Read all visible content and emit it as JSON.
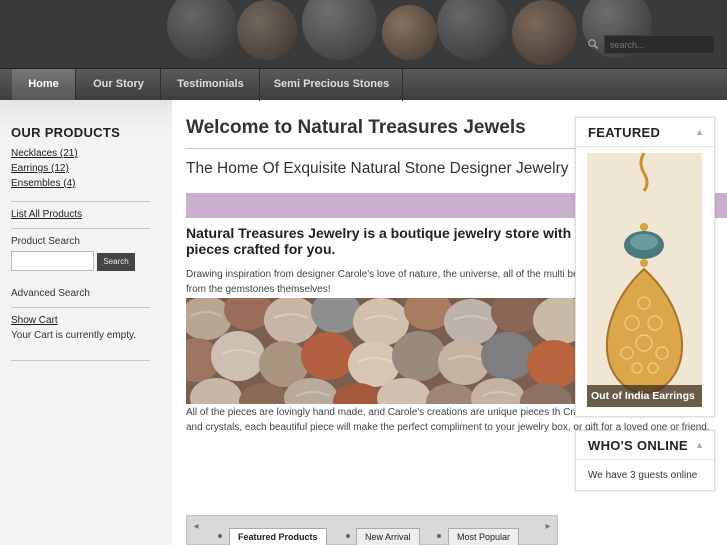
{
  "header": {
    "search_placeholder": "search..."
  },
  "nav": {
    "tabs": [
      "Home",
      "Our Story",
      "Testimonials",
      "Semi Precious Stones"
    ],
    "active_tab": "Home"
  },
  "sidebar": {
    "heading": "OUR PRODUCTS",
    "categories": [
      "Necklaces (21)",
      "Earrings (12)",
      "Ensembles (4)"
    ],
    "list_all": "List All Products",
    "product_search_label": "Product Search",
    "search_button": "Search",
    "advanced_search": "Advanced Search",
    "show_cart": "Show Cart",
    "cart_status": "Your Cart is currently empty."
  },
  "main": {
    "title": "Welcome to Natural Treasures Jewels",
    "subtitle": "The Home Of Exquisite Natural Stone Designer Jewelry",
    "intro_heading": "Natural Treasures Jewelry is a boutique jewelry store with pieces crafted for you.",
    "paragraph_1": "Drawing inspiration from designer Carole's love of nature, the universe, all of the multi beautiful pieces of art, and also from the gemstones themselves!",
    "paragraph_2": "All of the pieces are lovingly hand made, and Carole's creations are unique pieces th Crafted from semi precious stones and crystals, each beautiful piece will make the perfect compliment to your jewelry box, or gift for a loved one or friend.",
    "product_tabs": [
      "Featured Products",
      "New Arrival",
      "Most Popular"
    ],
    "selected_product_tab": "Featured Products"
  },
  "right": {
    "featured_heading": "FEATURED",
    "featured_caption": "Out of India Earrings",
    "online_heading": "WHO'S ONLINE",
    "online_text": "We have 3 guests online"
  },
  "colors": {
    "accent_bar": "#c9b0cd",
    "header_bg": "#3a3a3a",
    "nav_bg": "#4a4a4a"
  }
}
